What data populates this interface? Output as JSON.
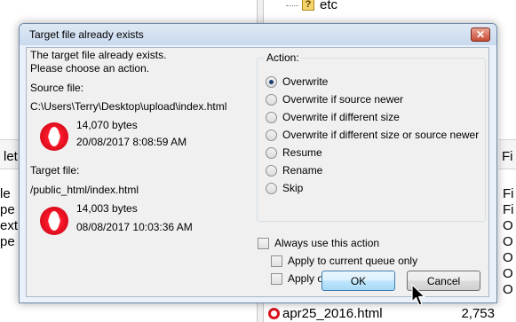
{
  "background": {
    "tree_item": "etc",
    "tree_icon": "?",
    "left_header_partial": "let",
    "right_header_partial": "Fi",
    "left_column_partial": [
      "le",
      "pe",
      "ext",
      "pe"
    ],
    "right_column_partial": [
      "Fi",
      "Fi",
      "O",
      "O",
      "O",
      "O",
      "O"
    ],
    "file_row": {
      "name": "apr25_2016.html",
      "size": "2,753"
    }
  },
  "dialog": {
    "title": "Target file already exists",
    "close_label": "✕",
    "message_line1": "The target file already exists.",
    "message_line2": "Please choose an action.",
    "source": {
      "label": "Source file:",
      "path": "C:\\Users\\Terry\\Desktop\\upload\\index.html",
      "size": "14,070 bytes",
      "date": "20/08/2017 8:08:59 AM"
    },
    "target": {
      "label": "Target file:",
      "path": "/public_html/index.html",
      "size": "14,003 bytes",
      "date": "08/08/2017 10:03:36 AM"
    },
    "action_group_label": "Action:",
    "actions": [
      {
        "label": "Overwrite",
        "checked": true
      },
      {
        "label": "Overwrite if source newer",
        "checked": false
      },
      {
        "label": "Overwrite if different size",
        "checked": false
      },
      {
        "label": "Overwrite if different size or source newer",
        "checked": false
      },
      {
        "label": "Resume",
        "checked": false
      },
      {
        "label": "Rename",
        "checked": false
      },
      {
        "label": "Skip",
        "checked": false
      }
    ],
    "always_use": "Always use this action",
    "apply_queue": "Apply to current queue only",
    "apply_uploads": "Apply only to uploads",
    "ok_label": "OK",
    "cancel_label": "Cancel"
  }
}
